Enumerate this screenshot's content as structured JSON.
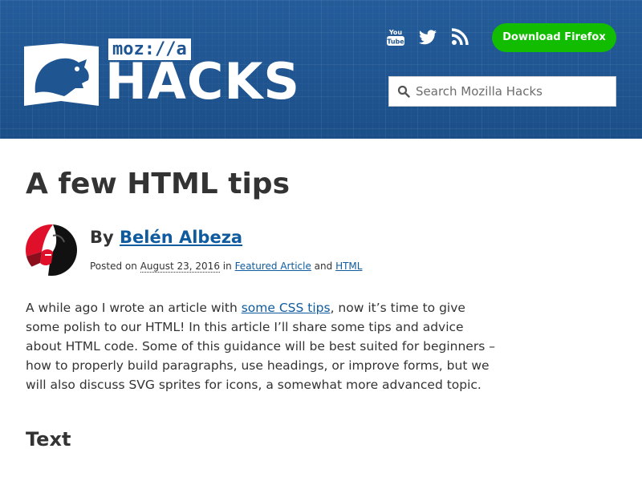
{
  "header": {
    "logo_badge": "moz://a",
    "logo_word": "HACKS",
    "social": [
      {
        "icon": "youtube-icon",
        "label": "YouTube"
      },
      {
        "icon": "twitter-icon",
        "label": "Twitter"
      },
      {
        "icon": "rss-icon",
        "label": "RSS"
      }
    ],
    "download_label": "Download Firefox",
    "search_placeholder": "Search Mozilla Hacks",
    "colors": {
      "banner": "#1f5591",
      "download": "#12bc00"
    }
  },
  "article": {
    "title": "A few HTML tips",
    "byline_prefix": "By",
    "author": "Belén Albeza",
    "posted_on": "Posted on",
    "date": "August 23, 2016",
    "in": "in",
    "category1": "Featured Article",
    "and": "and",
    "category2": "HTML",
    "intro_pre": "A while ago I wrote an article with",
    "intro_link": "some CSS tips",
    "intro_post": ", now it’s time to give some polish to our HTML! In this article I’ll share some tips and advice about HTML code. Some of this guidance will be best suited for beginners – how to properly build paragraphs, use headings, or improve forms, but we will also discuss SVG sprites for icons, a somewhat more advanced topic.",
    "section_heading": "Text",
    "link_color": "#0f5b9e"
  }
}
